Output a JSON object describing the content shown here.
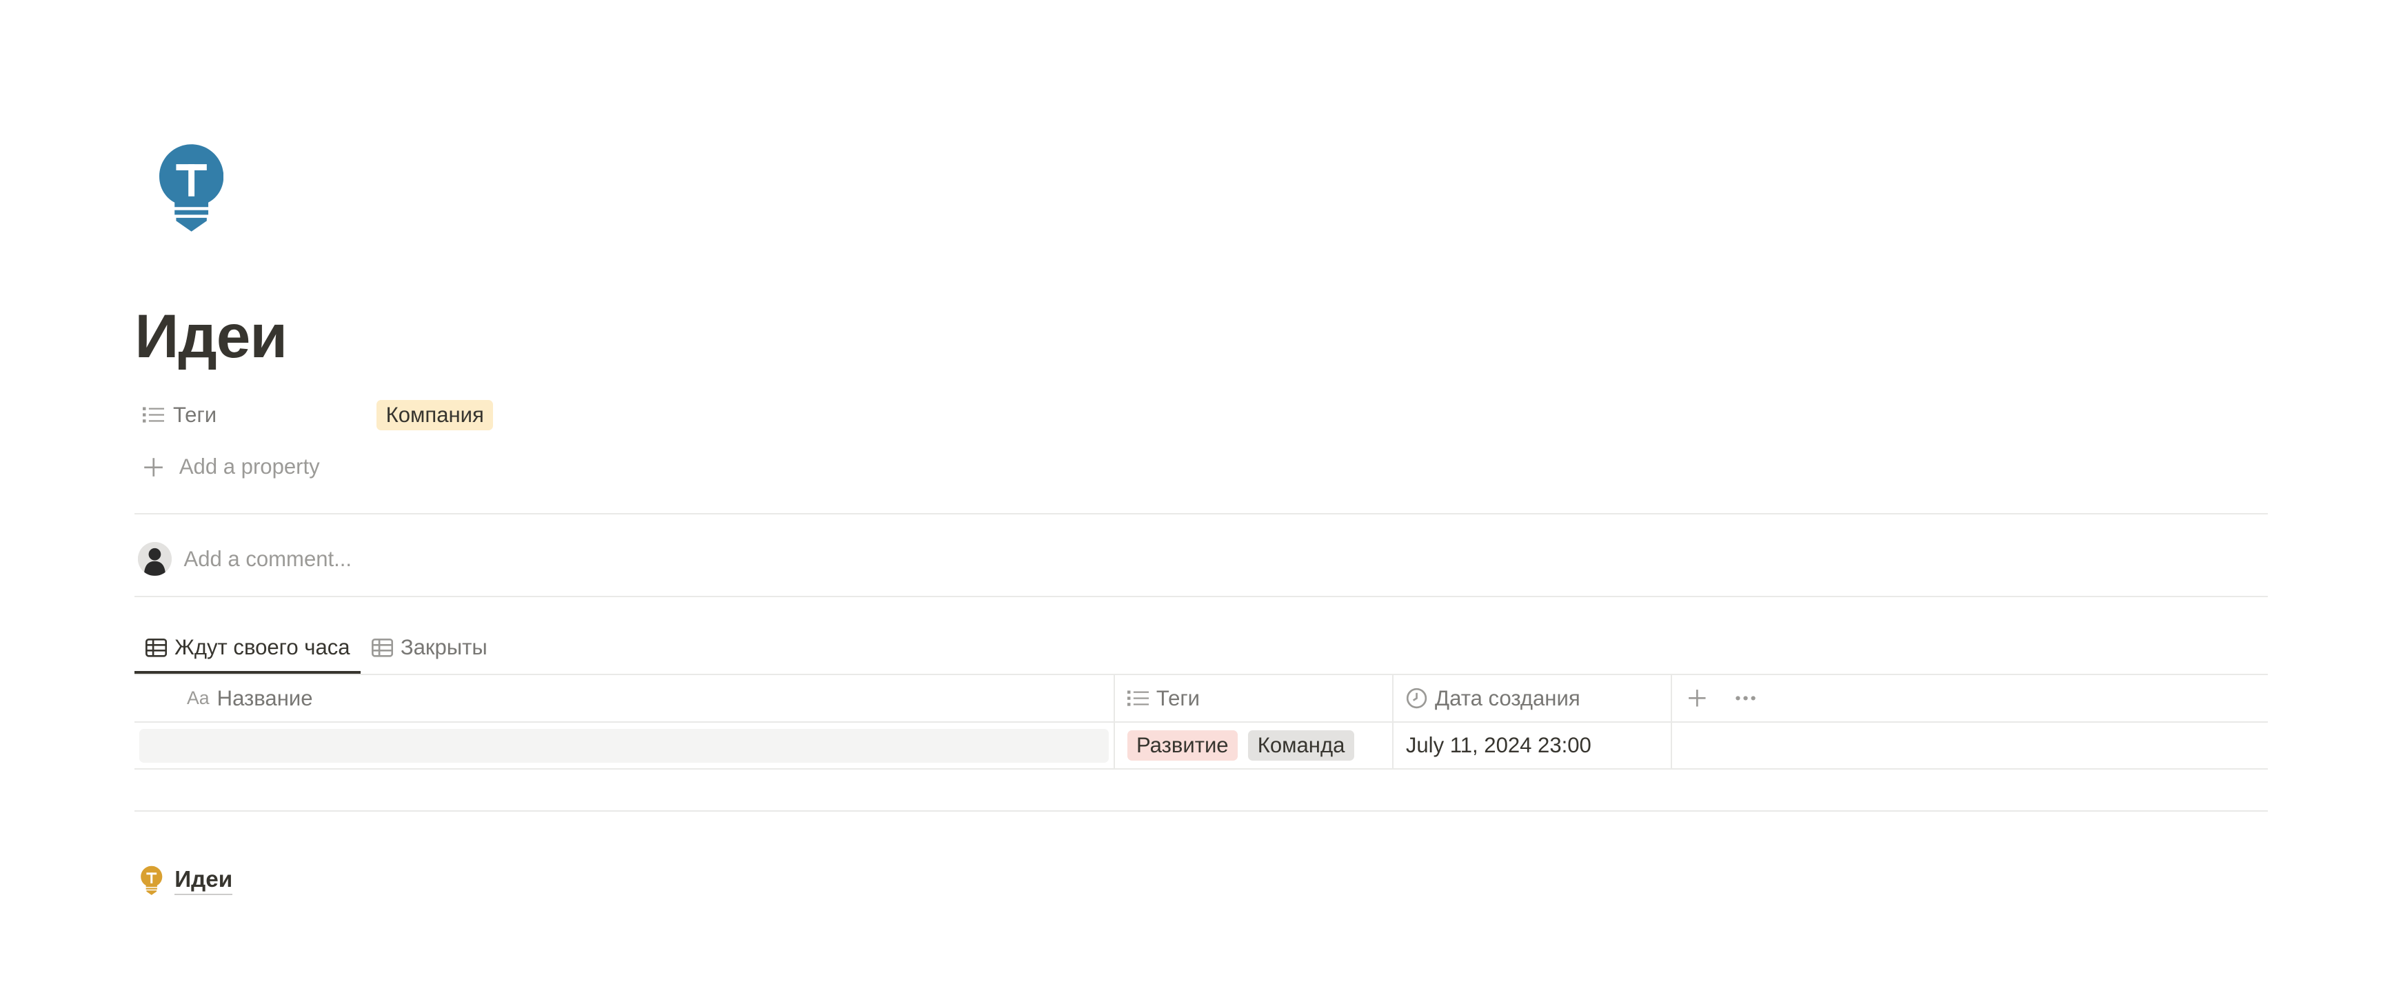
{
  "page": {
    "icon": "lightbulb-t-icon",
    "title": "Идеи"
  },
  "properties": {
    "tags": {
      "label": "Теги",
      "icon": "list-icon",
      "values": [
        {
          "label": "Компания",
          "color": "#fdecc8"
        }
      ]
    },
    "add_property_label": "Add a property"
  },
  "comments": {
    "placeholder": "Add a comment..."
  },
  "database": {
    "views": [
      {
        "label": "Ждут своего часа",
        "icon": "table-icon",
        "active": true
      },
      {
        "label": "Закрыты",
        "icon": "table-icon",
        "active": false
      }
    ],
    "columns": [
      {
        "label": "Название",
        "icon": "text-aa-icon"
      },
      {
        "label": "Теги",
        "icon": "list-icon"
      },
      {
        "label": "Дата создания",
        "icon": "clock-icon"
      }
    ],
    "rows": [
      {
        "name": "",
        "tags": [
          {
            "label": "Развитие",
            "color": "#fadeda"
          },
          {
            "label": "Команда",
            "color": "#e3e2e0"
          }
        ],
        "created": "July 11, 2024 23:00"
      }
    ]
  },
  "linked_page": {
    "icon": "lightbulb-t-icon",
    "title": "Идеи"
  },
  "colors": {
    "icon_blue": "#337ea9",
    "icon_orange": "#d9a030",
    "text": "#37352f",
    "muted": "#787774"
  }
}
